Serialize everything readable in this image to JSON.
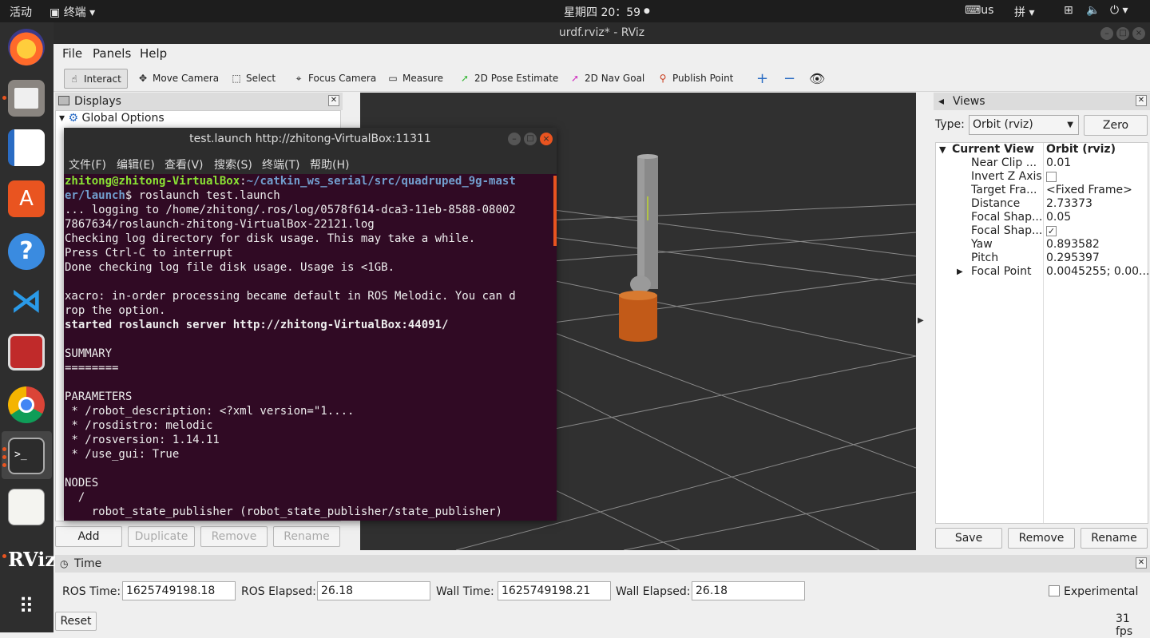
{
  "topbar": {
    "activities": "活动",
    "app": "终端",
    "clock": "星期四 20：59",
    "kbd": "us",
    "ime": "拼"
  },
  "window": {
    "title": "urdf.rviz* - RViz"
  },
  "menu": {
    "file": "File",
    "panels": "Panels",
    "help": "Help"
  },
  "toolbar": {
    "interact": "Interact",
    "move_camera": "Move Camera",
    "select": "Select",
    "focus_camera": "Focus Camera",
    "measure": "Measure",
    "pose_estimate": "2D Pose Estimate",
    "nav_goal": "2D Nav Goal",
    "publish_point": "Publish Point"
  },
  "displays": {
    "title": "Displays",
    "global_options": "Global Options",
    "add": "Add",
    "duplicate": "Duplicate",
    "remove": "Remove",
    "rename": "Rename"
  },
  "views": {
    "title": "Views",
    "type_label": "Type:",
    "type_value": "Orbit (rviz)",
    "zero": "Zero",
    "current_view": "Current View",
    "current_view_value": "Orbit (rviz)",
    "props": [
      {
        "name": "Near Clip ...",
        "value": "0.01"
      },
      {
        "name": "Invert Z Axis",
        "value": ""
      },
      {
        "name": "Target Fra...",
        "value": "<Fixed Frame>"
      },
      {
        "name": "Distance",
        "value": "2.73373"
      },
      {
        "name": "Focal Shap...",
        "value": "0.05"
      },
      {
        "name": "Focal Shap...",
        "value": "✓"
      },
      {
        "name": "Yaw",
        "value": "0.893582"
      },
      {
        "name": "Pitch",
        "value": "0.295397"
      },
      {
        "name": "Focal Point",
        "value": "0.0045255; 0.00..."
      }
    ],
    "save": "Save",
    "remove": "Remove",
    "rename": "Rename"
  },
  "time": {
    "title": "Time",
    "ros_time_label": "ROS Time:",
    "ros_time": "1625749198.18",
    "ros_elapsed_label": "ROS Elapsed:",
    "ros_elapsed": "26.18",
    "wall_time_label": "Wall Time:",
    "wall_time": "1625749198.21",
    "wall_elapsed_label": "Wall Elapsed:",
    "wall_elapsed": "26.18",
    "experimental": "Experimental",
    "reset": "Reset",
    "fps": "31 fps"
  },
  "terminal": {
    "title": "test.launch http://zhitong-VirtualBox:11311",
    "menu": [
      "文件(F)",
      "编辑(E)",
      "查看(V)",
      "搜索(S)",
      "终端(T)",
      "帮助(H)"
    ],
    "prompt_user": "zhitong@zhitong-VirtualBox",
    "prompt_path": "~/catkin_ws_serial/src/quadruped_9g-mast",
    "prompt_path2": "er/launch",
    "command": "$ roslaunch test.launch",
    "lines": [
      "... logging to /home/zhitong/.ros/log/0578f614-dca3-11eb-8588-08002",
      "7867634/roslaunch-zhitong-VirtualBox-22121.log",
      "Checking log directory for disk usage. This may take a while.",
      "Press Ctrl-C to interrupt",
      "Done checking log file disk usage. Usage is <1GB.",
      "",
      "xacro: in-order processing became default in ROS Melodic. You can d",
      "rop the option."
    ],
    "started": "started roslaunch server http://zhitong-VirtualBox:44091/",
    "lines2": [
      "",
      "SUMMARY",
      "========",
      "",
      "PARAMETERS",
      " * /robot_description: <?xml version=\"1....",
      " * /rosdistro: melodic",
      " * /rosversion: 1.14.11",
      " * /use_gui: True",
      "",
      "NODES",
      "  /",
      "    robot_state_publisher (robot_state_publisher/state_publisher)"
    ]
  },
  "dock_icons": [
    "firefox-icon",
    "files-icon",
    "writer-icon",
    "software-icon",
    "help-icon",
    "vscode-icon",
    "terminal-red-icon",
    "chrome-icon",
    "terminal-icon",
    "editor-icon",
    "rviz-icon",
    "apps-grid-icon"
  ],
  "dock_rviz_label": "RViz"
}
